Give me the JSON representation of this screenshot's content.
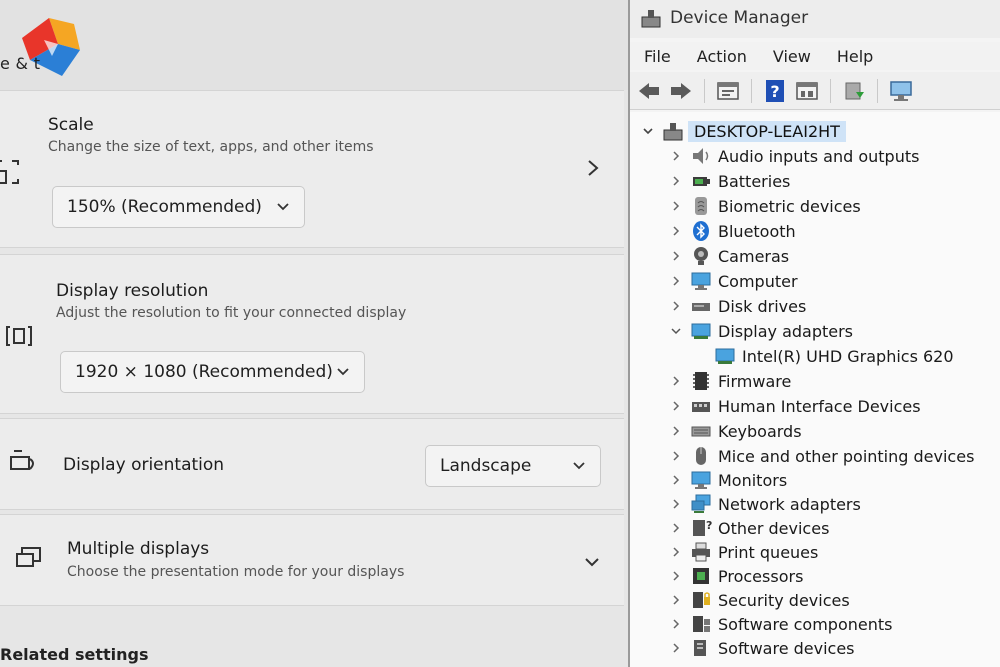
{
  "settings": {
    "header_title": "e & t",
    "scale": {
      "title": "Scale",
      "subtitle": "Change the size of text, apps, and other items",
      "value": "150% (Recommended)"
    },
    "resolution": {
      "title": "Display resolution",
      "subtitle": "Adjust the resolution to fit your connected display",
      "value": "1920 × 1080 (Recommended)"
    },
    "orientation": {
      "title": "Display orientation",
      "value": "Landscape"
    },
    "multiple": {
      "title": "Multiple displays",
      "subtitle": "Choose the presentation mode for your displays"
    },
    "related": "Related settings"
  },
  "device_manager": {
    "title": "Device Manager",
    "menu": [
      "File",
      "Action",
      "View",
      "Help"
    ],
    "root": "DESKTOP-LEAI2HT",
    "items": [
      {
        "label": "Audio inputs and outputs",
        "icon": "speaker-icon",
        "expanded": false
      },
      {
        "label": "Batteries",
        "icon": "battery-icon",
        "expanded": false
      },
      {
        "label": "Biometric devices",
        "icon": "fingerprint-icon",
        "expanded": false
      },
      {
        "label": "Bluetooth",
        "icon": "bluetooth-icon",
        "expanded": false
      },
      {
        "label": "Cameras",
        "icon": "camera-icon",
        "expanded": false
      },
      {
        "label": "Computer",
        "icon": "computer-icon",
        "expanded": false
      },
      {
        "label": "Disk drives",
        "icon": "disk-icon",
        "expanded": false
      },
      {
        "label": "Display adapters",
        "icon": "display-adapter-icon",
        "expanded": true
      },
      {
        "label": "Intel(R) UHD Graphics 620",
        "icon": "display-adapter-icon",
        "child": true
      },
      {
        "label": "Firmware",
        "icon": "firmware-icon",
        "expanded": false
      },
      {
        "label": "Human Interface Devices",
        "icon": "hid-icon",
        "expanded": false
      },
      {
        "label": "Keyboards",
        "icon": "keyboard-icon",
        "expanded": false
      },
      {
        "label": "Mice and other pointing devices",
        "icon": "mouse-icon",
        "expanded": false
      },
      {
        "label": "Monitors",
        "icon": "monitor-icon",
        "expanded": false
      },
      {
        "label": "Network adapters",
        "icon": "network-icon",
        "expanded": false
      },
      {
        "label": "Other devices",
        "icon": "other-devices-icon",
        "expanded": false
      },
      {
        "label": "Print queues",
        "icon": "printer-icon",
        "expanded": false
      },
      {
        "label": "Processors",
        "icon": "processor-icon",
        "expanded": false
      },
      {
        "label": "Security devices",
        "icon": "security-icon",
        "expanded": false
      },
      {
        "label": "Software components",
        "icon": "software-component-icon",
        "expanded": false
      },
      {
        "label": "Software devices",
        "icon": "software-device-icon",
        "expanded": false
      }
    ]
  },
  "colors": {
    "accent_blue": "#1f6fd1",
    "selection": "#cfe3f7"
  }
}
